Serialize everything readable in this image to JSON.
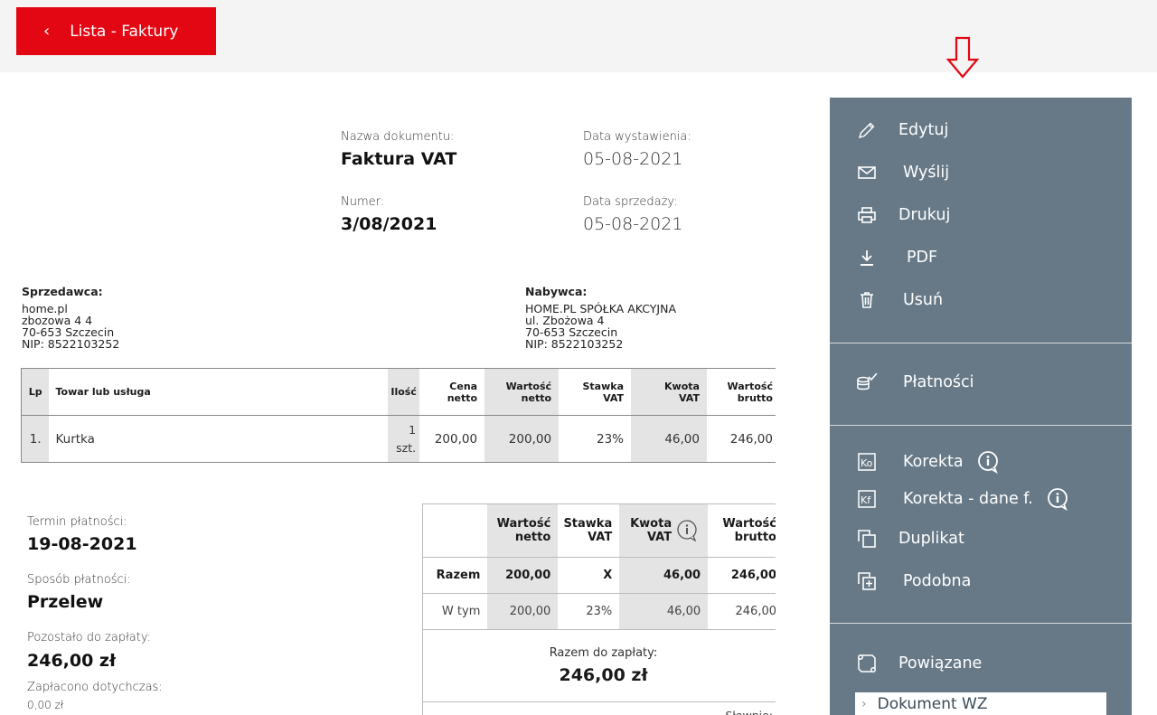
{
  "header": {
    "back_label": "Lista - Faktury"
  },
  "document": {
    "name_label": "Nazwa dokumentu:",
    "name": "Faktura VAT",
    "issue_date_label": "Data wystawienia:",
    "issue_date": "05-08-2021",
    "number_label": "Numer:",
    "number": "3/08/2021",
    "sale_date_label": "Data sprzedaży:",
    "sale_date": "05-08-2021"
  },
  "seller": {
    "title": "Sprzedawca:",
    "lines": [
      "home.pl",
      "zbozowa 4 4",
      "70-653 Szczecin",
      "NIP: 8522103252"
    ]
  },
  "buyer": {
    "title": "Nabywca:",
    "lines": [
      "HOME.PL SPÓŁKA AKCYJNA",
      "ul. Zbożowa 4",
      "70-653 Szczecin",
      "NIP: 8522103252"
    ]
  },
  "items_table": {
    "headers": {
      "lp": "Lp",
      "name": "Towar lub usługa",
      "qty": "Ilość",
      "net_price_1": "Cena",
      "net_price_2": "netto",
      "net_value_1": "Wartość",
      "net_value_2": "netto",
      "vat_rate_1": "Stawka",
      "vat_rate_2": "VAT",
      "vat_amount_1": "Kwota",
      "vat_amount_2": "VAT",
      "gross_1": "Wartość",
      "gross_2": "brutto"
    },
    "rows": [
      {
        "lp": "1.",
        "name": "Kurtka",
        "qty": "1",
        "unit": "szt.",
        "net_price": "200,00",
        "net_value": "200,00",
        "vat_rate": "23%",
        "vat_amount": "46,00",
        "gross": "246,00"
      }
    ]
  },
  "payment": {
    "due_label": "Termin płatności:",
    "due": "19-08-2021",
    "method_label": "Sposób płatności:",
    "method": "Przelew",
    "remaining_label": "Pozostało do zapłaty:",
    "remaining": "246,00 zł",
    "paid_label": "Zapłacono dotychczas:",
    "paid": "0,00 zł"
  },
  "summary_table": {
    "headers": {
      "net_1": "Wartość",
      "net_2": "netto",
      "rate_1": "Stawka",
      "rate_2": "VAT",
      "vat_1": "Kwota",
      "vat_2": "VAT",
      "gross_1": "Wartość",
      "gross_2": "brutto"
    },
    "total_row": {
      "label": "Razem",
      "net": "200,00",
      "rate": "X",
      "vat": "46,00",
      "gross": "246,00"
    },
    "detail_row": {
      "label": "W tym",
      "net": "200,00",
      "rate": "23%",
      "vat": "46,00",
      "gross": "246,00"
    },
    "to_pay_label": "Razem do zapłaty:",
    "to_pay": "246,00 zł",
    "in_words_label": "Słownie:"
  },
  "sidebar": {
    "edit": "Edytuj",
    "send": "Wyślij",
    "print": "Drukuj",
    "pdf": "PDF",
    "delete": "Usuń",
    "payments": "Płatności",
    "correction": "Korekta",
    "correction_data": "Korekta - dane f.",
    "duplicate": "Duplikat",
    "similar": "Podobna",
    "related": "Powiązane",
    "related_doc": "Dokument WZ"
  },
  "colors": {
    "accent": "#e30613",
    "sidebar": "#677987"
  }
}
